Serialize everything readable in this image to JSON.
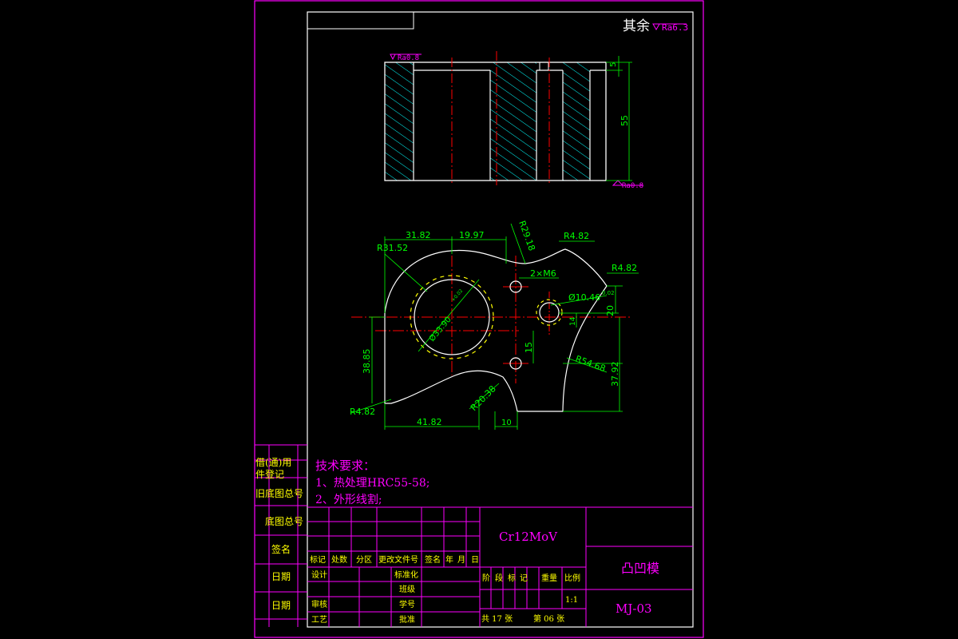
{
  "corner_roughness": {
    "prefix": "其余",
    "value": "Ra6.3"
  },
  "section_view": {
    "top_roughness": "Ra0.8",
    "bottom_roughness": "Ra0.8",
    "dim_top": "5",
    "dim_height": "55"
  },
  "plan_view": {
    "dims": {
      "d3182": "31.82",
      "d1997": "19.97",
      "r2918": "R29.18",
      "r482_top": "R4.82",
      "r482_right": "R4.82",
      "r3152": "R31.52",
      "m6": "2×M6",
      "d10": "Ø10.46",
      "d1046_small": "Ø10.46",
      "d02": "0.02",
      "d20": "20",
      "d14": "14",
      "d15": "15",
      "d3885": "38.85",
      "d3792": "37.92",
      "r5468": "R54.68",
      "r2038": "R20.38",
      "r482_left": "R4.82",
      "d4182": "41.82",
      "d10b": "10",
      "big_dia": "Ø33.90",
      "big_tol": "+0.02"
    }
  },
  "tech_requirements": {
    "title": "技术要求：",
    "item1": "1、热处理HRC55-58;",
    "item2": "2、外形线割;"
  },
  "left_strip": [
    "借(通)用",
    "件登记",
    "旧底图总号",
    "底图总号",
    "签名",
    "日期",
    "日期"
  ],
  "title_block": {
    "material": "Cr12MoV",
    "part_name": "凸凹模",
    "drawing_no": "MJ-03",
    "scale": "1:1",
    "total_sheets": "共 17 张",
    "sheet_no": "第 06 张",
    "rev_headers": [
      "标记",
      "处数",
      "分区",
      "更改文件号",
      "签名",
      "年",
      "月",
      "日"
    ],
    "sign_labels": [
      "设计",
      "审核",
      "工艺"
    ],
    "std_labels": [
      "标准化",
      "班级",
      "学号",
      "批准"
    ],
    "stage_headers": [
      "阶",
      "段",
      "标",
      "记",
      "重量",
      "比例"
    ]
  },
  "colors": {
    "frame": "#ff00ff",
    "outline": "#ffffff",
    "center": "#ff0000",
    "dim": "#00ff00",
    "hatch": "#00ffff",
    "text_magenta": "#ff00ff",
    "text_yellow": "#ffff00"
  }
}
